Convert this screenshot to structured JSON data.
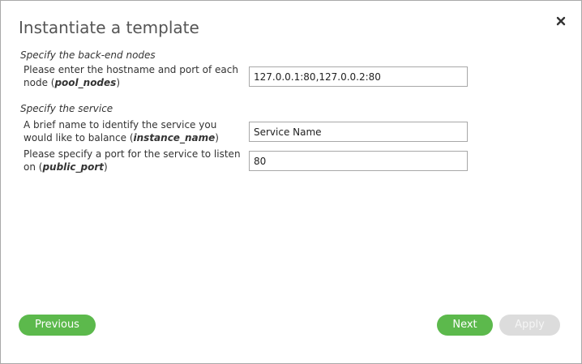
{
  "dialog": {
    "title": "Instantiate a template"
  },
  "sections": [
    {
      "title": "Specify the back-end nodes",
      "fields": [
        {
          "label_pre": "Please enter the hostname and port of each node (",
          "param": "pool_nodes",
          "label_post": ")",
          "value": "127.0.0.1:80,127.0.0.2:80"
        }
      ]
    },
    {
      "title": "Specify the service",
      "fields": [
        {
          "label_pre": "A brief name to identify the service you would like to balance (",
          "param": "instance_name",
          "label_post": ")",
          "value": "Service Name"
        },
        {
          "label_pre": "Please specify a port for the service to listen on (",
          "param": "public_port",
          "label_post": ")",
          "value": "80"
        }
      ]
    }
  ],
  "buttons": {
    "previous": "Previous",
    "next": "Next",
    "apply": "Apply"
  },
  "icons": {
    "close": "close-icon"
  },
  "colors": {
    "primary_button": "#5cb94c",
    "disabled_button": "#dcdcdc",
    "title_text": "#555555"
  }
}
